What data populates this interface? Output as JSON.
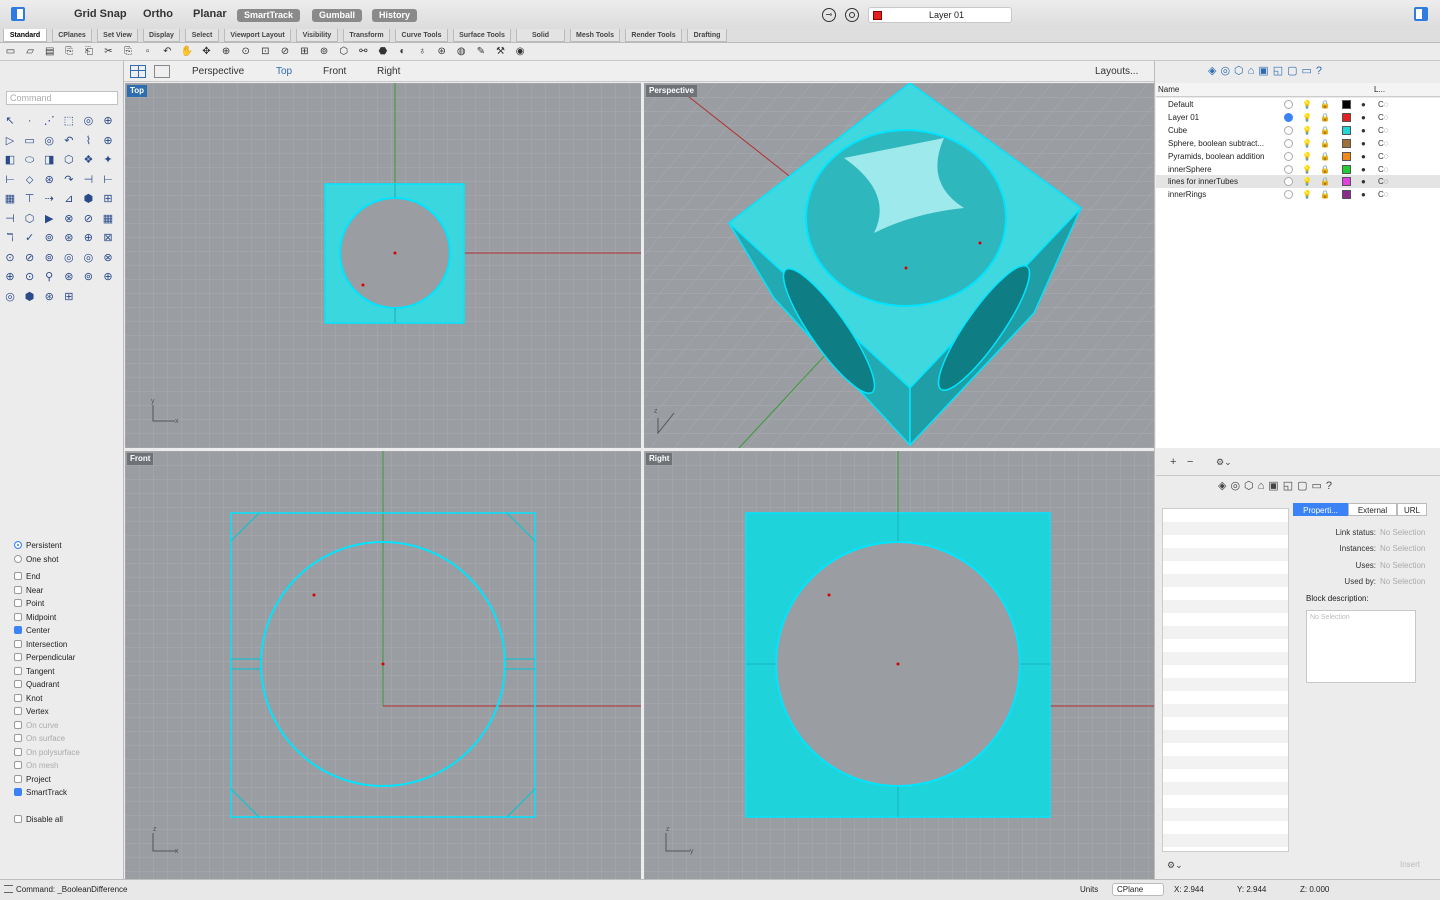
{
  "toolbar": {
    "grid_snap": "Grid Snap",
    "ortho": "Ortho",
    "planar": "Planar",
    "smarttrack": "SmartTrack",
    "gumball": "Gumball",
    "history": "History",
    "current_layer": "Layer 01",
    "current_layer_color": "#e32020"
  },
  "tabs": [
    "Standard",
    "CPlanes",
    "Set View",
    "Display",
    "Select",
    "Viewport Layout",
    "Visibility",
    "Transform",
    "Curve Tools",
    "Surface Tools",
    "Solid Tools",
    "Mesh Tools",
    "Render Tools",
    "Drafting"
  ],
  "command": {
    "placeholder": "Command",
    "last": "Command: _BooleanDifference"
  },
  "viewport_tabs": {
    "perspective": "Perspective",
    "top": "Top",
    "front": "Front",
    "right": "Right",
    "layouts": "Layouts..."
  },
  "viewports": {
    "top": "Top",
    "perspective": "Perspective",
    "front": "Front",
    "right": "Right"
  },
  "osnaps": {
    "persistent": "Persistent",
    "one_shot": "One shot",
    "items": [
      {
        "label": "End",
        "on": false,
        "dis": false
      },
      {
        "label": "Near",
        "on": false,
        "dis": false
      },
      {
        "label": "Point",
        "on": false,
        "dis": false
      },
      {
        "label": "Midpoint",
        "on": false,
        "dis": false
      },
      {
        "label": "Center",
        "on": true,
        "dis": false
      },
      {
        "label": "Intersection",
        "on": false,
        "dis": false
      },
      {
        "label": "Perpendicular",
        "on": false,
        "dis": false
      },
      {
        "label": "Tangent",
        "on": false,
        "dis": false
      },
      {
        "label": "Quadrant",
        "on": false,
        "dis": false
      },
      {
        "label": "Knot",
        "on": false,
        "dis": false
      },
      {
        "label": "Vertex",
        "on": false,
        "dis": false
      },
      {
        "label": "On curve",
        "on": false,
        "dis": true
      },
      {
        "label": "On surface",
        "on": false,
        "dis": true
      },
      {
        "label": "On polysurface",
        "on": false,
        "dis": true
      },
      {
        "label": "On mesh",
        "on": false,
        "dis": true
      },
      {
        "label": "Project",
        "on": false,
        "dis": false
      },
      {
        "label": "SmartTrack",
        "on": true,
        "dis": false
      }
    ],
    "disable_all": "Disable all"
  },
  "layers": {
    "header_name": "Name",
    "header_l": "L...",
    "rows": [
      {
        "name": "Default",
        "color": "#000000",
        "current": false
      },
      {
        "name": "Layer 01",
        "color": "#e32020",
        "current": true
      },
      {
        "name": "Cube",
        "color": "#22d6d6",
        "current": false
      },
      {
        "name": "Sphere, boolean subtract...",
        "color": "#a0703a",
        "current": false
      },
      {
        "name": "Pyramids, boolean addition",
        "color": "#f08a1c",
        "current": false
      },
      {
        "name": "innerSphere",
        "color": "#22cc33",
        "current": false
      },
      {
        "name": "lines for innerTubes",
        "color": "#e040e0",
        "current": false
      },
      {
        "name": "innerRings",
        "color": "#8a2a8a",
        "current": false
      }
    ]
  },
  "properties": {
    "tabs": [
      "Properti...",
      "External",
      "URL"
    ],
    "link_status": "Link status:",
    "instances": "Instances:",
    "uses": "Uses:",
    "used_by": "Used by:",
    "no_selection": "No Selection",
    "block_description": "Block description:",
    "insert": "Insert"
  },
  "status": {
    "units": "Units",
    "cplane": "CPlane",
    "x": "X: 2.944",
    "y": "Y: 2.944",
    "z": "Z: 0.000"
  }
}
